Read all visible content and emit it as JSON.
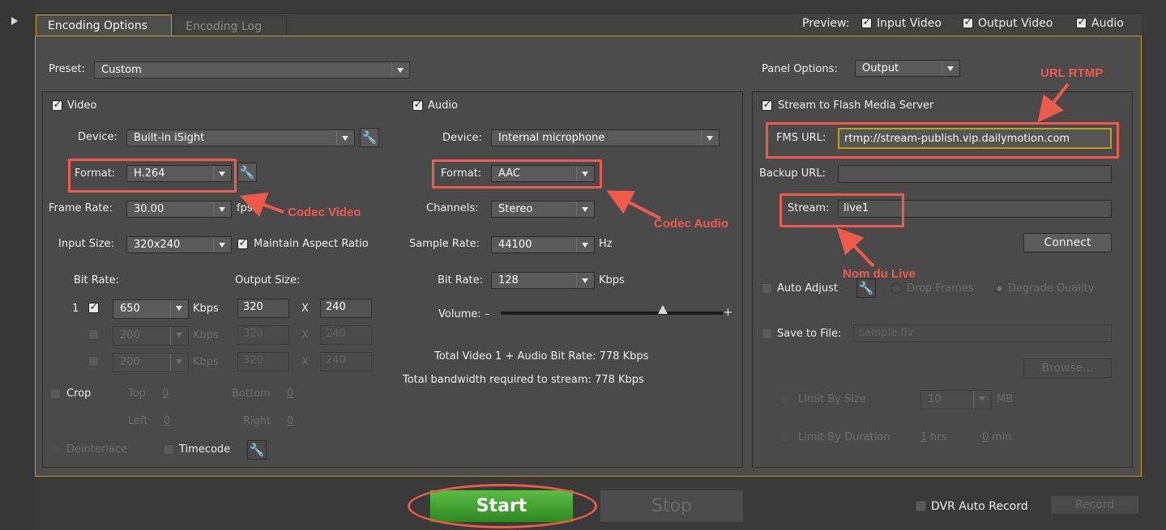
{
  "tabs": [
    "Encoding Options",
    "Encoding Log"
  ],
  "preview": {
    "label": "Preview:",
    "input_video": "Input Video",
    "output_video": "Output Video",
    "audio": "Audio"
  },
  "preset": {
    "label": "Preset:",
    "value": "Custom"
  },
  "panel_options": {
    "label": "Panel Options:",
    "value": "Output"
  },
  "video": {
    "title": "Video",
    "device_label": "Device:",
    "device": "Built-in iSight",
    "format_label": "Format:",
    "format": "H.264",
    "frame_rate_label": "Frame Rate:",
    "frame_rate": "30.00",
    "fps": "fps",
    "input_size_label": "Input Size:",
    "input_size": "320x240",
    "maintain_aspect": "Maintain Aspect Ratio",
    "bit_rate_label": "Bit Rate:",
    "output_size_label": "Output Size:",
    "row_num": "1",
    "kbps": "Kbps",
    "x": "X",
    "rows": [
      {
        "rate": "650",
        "w": "320",
        "h": "240"
      },
      {
        "rate": "200",
        "w": "320",
        "h": "240"
      },
      {
        "rate": "200",
        "w": "320",
        "h": "240"
      }
    ],
    "crop": "Crop",
    "top": "Top",
    "top_v": "0",
    "bottom": "Bottom",
    "bottom_v": "0",
    "left": "Left",
    "left_v": "0",
    "right": "Right",
    "right_v": "0",
    "deinterlace": "Deinterlace",
    "timecode": "Timecode"
  },
  "audio": {
    "title": "Audio",
    "device_label": "Device:",
    "device": "Internal microphone",
    "format_label": "Format:",
    "format": "AAC",
    "channels_label": "Channels:",
    "channels": "Stereo",
    "sample_rate_label": "Sample Rate:",
    "sample_rate": "44100",
    "hz": "Hz",
    "bit_rate_label": "Bit Rate:",
    "bit_rate": "128",
    "kbps": "Kbps",
    "volume_label": "Volume:",
    "volume_minus": "–",
    "volume_plus": "+",
    "volume_level": 0.73,
    "total_rate": "Total Video 1 + Audio Bit Rate: 778 Kbps",
    "total_bandwidth": "Total bandwidth required to stream: 778 Kbps"
  },
  "fms": {
    "stream_to": "Stream to Flash Media Server",
    "fms_url_label": "FMS URL:",
    "fms_url": "rtmp://stream-publish.vip.dailymotion.com",
    "backup_url_label": "Backup URL:",
    "backup_url": "",
    "stream_label": "Stream:",
    "stream": "live1",
    "connect": "Connect",
    "auto_adjust": "Auto Adjust",
    "drop_frames": "Drop Frames",
    "degrade_quality": "Degrade Quality",
    "save_to_file": "Save to File:",
    "file_name": "sample.flv",
    "browse": "Browse...",
    "limit_size": "Limit By Size",
    "size_value": "10",
    "mb": "MB",
    "limit_duration": "Limit By Duration",
    "hrs_v": "1",
    "hrs": "hrs",
    "min_v": "0",
    "min": "min"
  },
  "bottom": {
    "start": "Start",
    "stop": "Stop",
    "dvr": "DVR Auto Record",
    "record": "Record"
  },
  "annotations": {
    "url_rtmp": "URL RTMP",
    "codec_video": "Codec Video",
    "codec_audio": "Codec Audio",
    "nom_du_live": "Nom du Live"
  },
  "colors": {
    "accent_border": "#c79a1d",
    "annotation": "#ee5b4a",
    "start_green": "#3e9e2c"
  }
}
